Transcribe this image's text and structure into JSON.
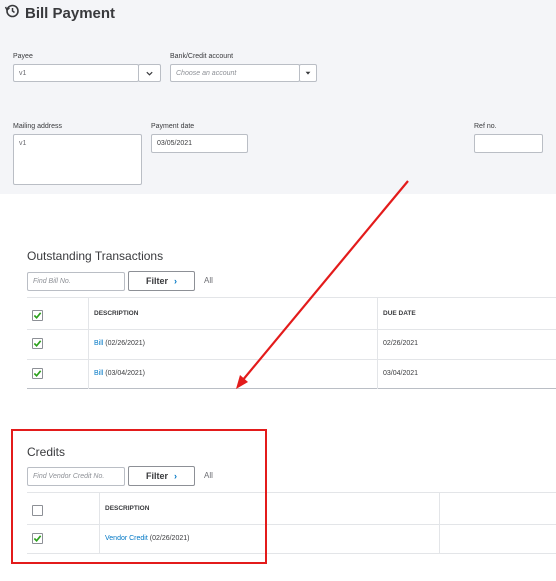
{
  "header": {
    "title": "Bill Payment",
    "payee_label": "Payee",
    "payee_value": "v1",
    "bank_label": "Bank/Credit account",
    "bank_placeholder": "Choose an account",
    "mailing_label": "Mailing address",
    "mailing_value": "v1",
    "payment_date_label": "Payment date",
    "payment_date_value": "03/05/2021",
    "ref_label": "Ref no.",
    "ref_value": ""
  },
  "outstanding": {
    "title": "Outstanding Transactions",
    "search_placeholder": "Find Bill No.",
    "filter_label": "Filter",
    "all_label": "All",
    "columns": [
      "DESCRIPTION",
      "DUE DATE"
    ],
    "rows": [
      {
        "link": "Bill",
        "date_part": " (02/26/2021)",
        "due": "02/26/2021",
        "checked": true
      },
      {
        "link": "Bill",
        "date_part": " (03/04/2021)",
        "due": "03/04/2021",
        "checked": true
      }
    ],
    "header_checked": true
  },
  "credits": {
    "title": "Credits",
    "search_placeholder": "Find Vendor Credit No.",
    "filter_label": "Filter",
    "all_label": "All",
    "columns": [
      "DESCRIPTION"
    ],
    "rows": [
      {
        "link": "Vendor Credit",
        "date_part": " (02/26/2021)",
        "checked": true
      }
    ],
    "header_checked": false
  },
  "colors": {
    "accent": "#0077c5",
    "checkbox_green": "#2ca01c",
    "annotation_red": "#e31b1b"
  },
  "icons": {
    "title_icon": "history-clock-icon",
    "dropdown": "chevron-down-icon",
    "filter_chevron": "chevron-right-icon",
    "checkbox": "check-icon"
  }
}
